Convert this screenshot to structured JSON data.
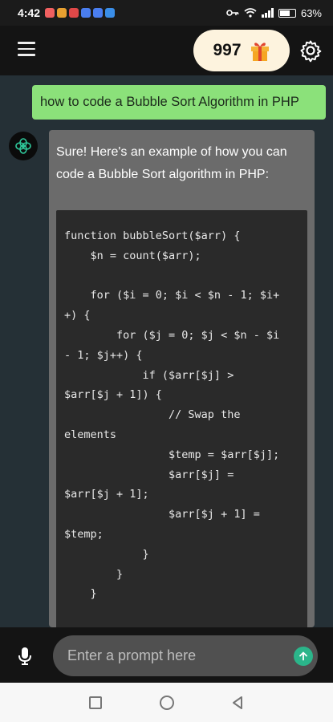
{
  "status_bar": {
    "time": "4:42",
    "battery": "63%",
    "notification_icons": [
      "#f06060",
      "#e8a030",
      "#e04848",
      "#4a7ef0",
      "#4a7ef0",
      "#3a8ee8"
    ]
  },
  "app_bar": {
    "credits": "997",
    "icons": {
      "menu": "hamburger-menu-icon",
      "gift": "gift-icon",
      "settings": "gear-icon"
    }
  },
  "chat": {
    "user_message": "how to code a Bubble Sort Algorithm in PHP",
    "bot_intro": "Sure! Here's an example of how you can code a Bubble Sort algorithm in PHP:",
    "code_lines": [
      "function bubbleSort($arr) {",
      "    $n = count($arr);",
      "",
      "    for ($i = 0; $i < $n - 1; $i+",
      "+) {",
      "        for ($j = 0; $j < $n - $i",
      "- 1; $j++) {",
      "            if ($arr[$j] >",
      "$arr[$j + 1]) {",
      "                // Swap the",
      "elements",
      "                $temp = $arr[$j];",
      "                $arr[$j] =",
      "$arr[$j + 1];",
      "                $arr[$j + 1] =",
      "$temp;",
      "            }",
      "        }",
      "    }"
    ]
  },
  "input": {
    "placeholder": "Enter a prompt here"
  },
  "colors": {
    "background": "#253036",
    "user_bubble": "#8be17a",
    "bot_bubble": "#6b6b6b",
    "accent": "#2bb58a"
  }
}
